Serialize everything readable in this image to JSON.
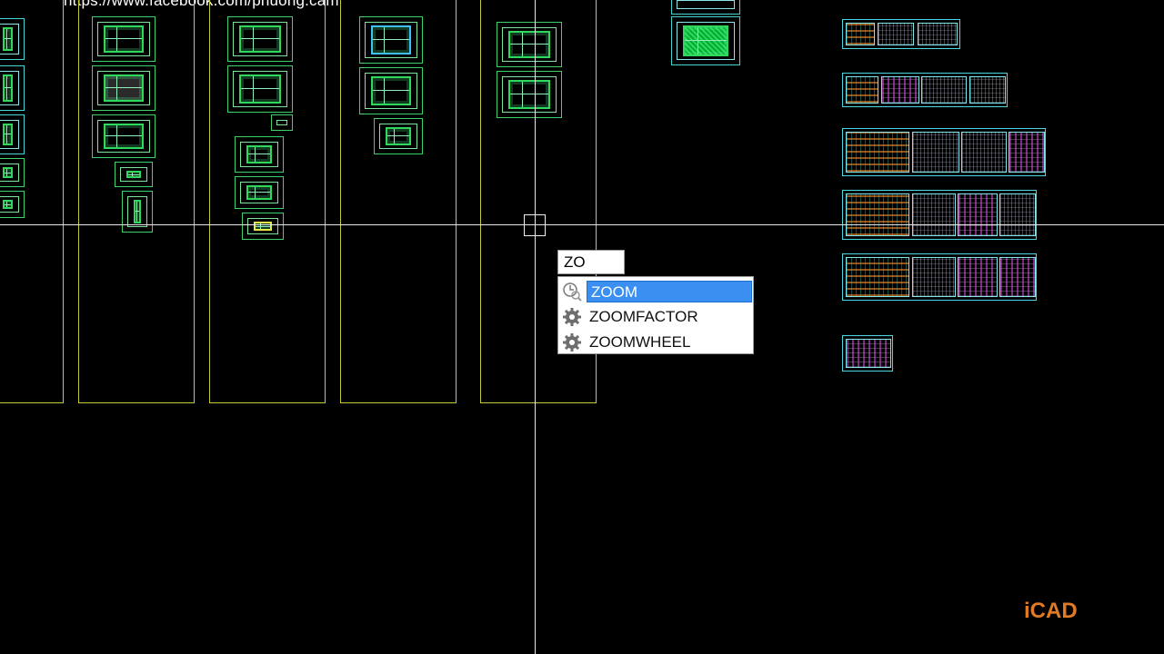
{
  "overlay": {
    "top_url_text": "https://www.facebook.com/phuong.cam",
    "brand_text": "iCAD",
    "brand_color": "#e07a25"
  },
  "command": {
    "typed_text": "ZO",
    "suggestions": [
      {
        "label": "ZOOM",
        "icon": "clock-icon",
        "selected": true
      },
      {
        "label": "ZOOMFACTOR",
        "icon": "gear-icon",
        "selected": false
      },
      {
        "label": "ZOOMWHEEL",
        "icon": "gear-icon",
        "selected": false
      }
    ],
    "selected_color": "#3b8ff0"
  },
  "colors": {
    "background": "#000000",
    "layout_frame": "#c8cc3a",
    "sheet_green": "#3fd26a",
    "sheet_cyan": "#49d8df",
    "crosshair": "#e8e8e8"
  }
}
